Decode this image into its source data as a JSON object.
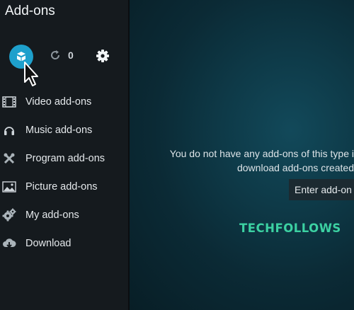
{
  "header": {
    "title": "Add-ons"
  },
  "toolbar": {
    "primary_button_icon": "open-box-icon",
    "refresh_icon": "refresh-icon",
    "update_count": "0",
    "settings_icon": "gear-icon"
  },
  "sidebar": {
    "items": [
      {
        "label": "Video add-ons",
        "icon": "film-icon"
      },
      {
        "label": "Music add-ons",
        "icon": "headphones-icon"
      },
      {
        "label": "Program add-ons",
        "icon": "tools-icon"
      },
      {
        "label": "Picture add-ons",
        "icon": "image-icon"
      },
      {
        "label": "My add-ons",
        "icon": "gears-icon"
      },
      {
        "label": "Download",
        "icon": "cloud-download-icon"
      }
    ]
  },
  "main": {
    "message_line1": "You do not have any add-ons of this type i",
    "message_line2": "download add-ons created",
    "enter_button_label": "Enter add-on b"
  },
  "watermark": {
    "text": "TECHFOLLOWS"
  },
  "colors": {
    "accent": "#1ea0cc",
    "watermark": "#3cd1a2",
    "sidebar_bg": "#151a1e"
  }
}
